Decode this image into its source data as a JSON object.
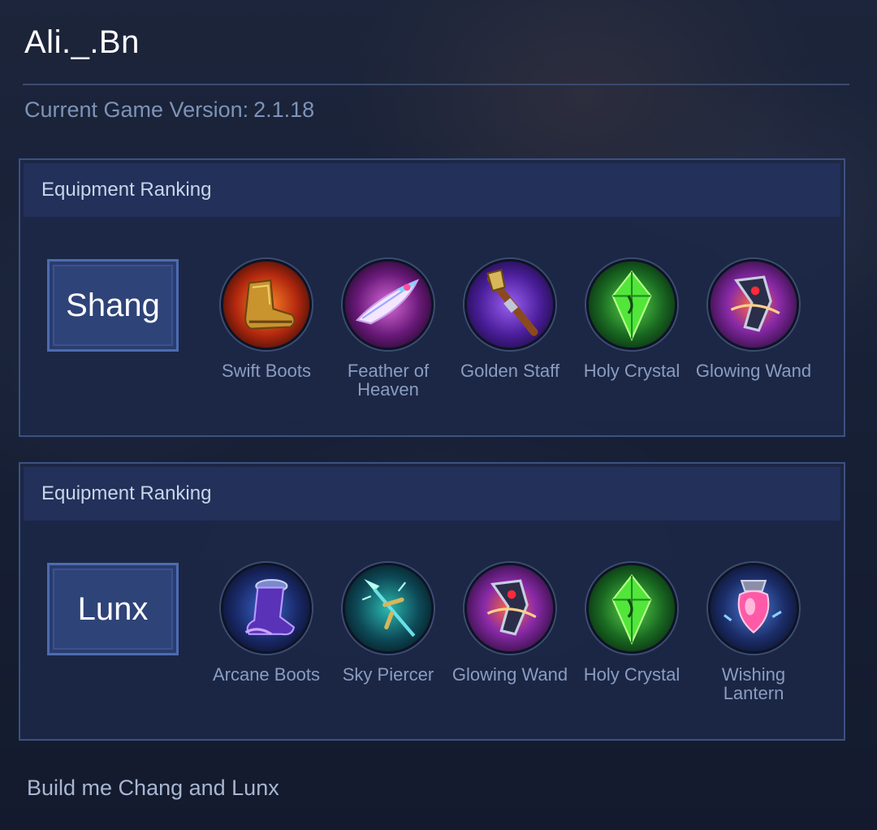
{
  "header": {
    "user_name": "Ali._.Bn",
    "version_label": "Current Game Version:",
    "version_number": "2.1.18"
  },
  "panels": [
    {
      "title": "Equipment Ranking",
      "hero": "Shang",
      "items": [
        {
          "name": "Swift Boots",
          "icon": "swift-boots-icon"
        },
        {
          "name": "Feather of Heaven",
          "icon": "feather-of-heaven-icon"
        },
        {
          "name": "Golden Staff",
          "icon": "golden-staff-icon"
        },
        {
          "name": "Holy Crystal",
          "icon": "holy-crystal-icon"
        },
        {
          "name": "Glowing Wand",
          "icon": "glowing-wand-icon"
        }
      ]
    },
    {
      "title": "Equipment Ranking",
      "hero": "Lunx",
      "items": [
        {
          "name": "Arcane Boots",
          "icon": "arcane-boots-icon"
        },
        {
          "name": "Sky Piercer",
          "icon": "sky-piercer-icon"
        },
        {
          "name": "Glowing Wand",
          "icon": "glowing-wand-icon"
        },
        {
          "name": "Holy Crystal",
          "icon": "holy-crystal-icon"
        },
        {
          "name": "Wishing Lantern",
          "icon": "wishing-lantern-icon"
        }
      ]
    }
  ],
  "message": {
    "text": "Build me Chang and Lunx"
  },
  "colors": {
    "panel_border": "#3d5180",
    "panel_header": "#22305a",
    "hero_box": "#2e4378",
    "muted_text": "#7d93b8"
  }
}
